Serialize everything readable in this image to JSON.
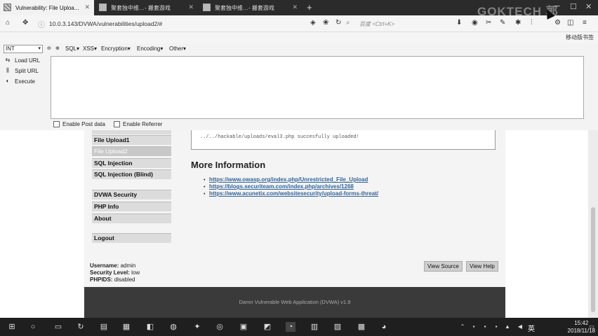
{
  "tabs": [
    {
      "label": "Vulnerability: File Uploa...",
      "active": true
    },
    {
      "label": "聚套独中维…- 搬套游戏",
      "active": false
    },
    {
      "label": "聚套独中维…- 搬套游戏",
      "active": false
    }
  ],
  "watermark": "GOKTECH 郭",
  "navbar": {
    "url": "10.0.3.143/DVWA/vulnerabilities/upload2/#",
    "search_placeholder": "百度 <Ctrl+K>"
  },
  "bookmarks": {
    "mobile": "移动版书签"
  },
  "hackbar": {
    "select_value": "INT",
    "menus": [
      "SQL▾",
      "XSS▾",
      "Encryption▾",
      "Encoding▾",
      "Other▾"
    ],
    "actions": [
      "Load URL",
      "Split URL",
      "Execute"
    ],
    "checkboxes": [
      "Enable Post data",
      "Enable Referrer"
    ]
  },
  "sidebar": {
    "items": [
      {
        "label": "File Upload1",
        "selected": false
      },
      {
        "label": "File Upload2",
        "selected": true
      },
      {
        "label": "SQL Injection",
        "selected": false
      },
      {
        "label": "SQL Injection (Blind)",
        "selected": false
      },
      {
        "label": "DVWA Security",
        "selected": false
      },
      {
        "label": "PHP Info",
        "selected": false
      },
      {
        "label": "About",
        "selected": false
      },
      {
        "label": "Logout",
        "selected": false
      }
    ]
  },
  "main": {
    "upload_message": "../../hackable/uploads/eval3.php succesfully uploaded!",
    "more_info_title": "More Information",
    "links": [
      "https://www.owasp.org/index.php/Unrestricted_File_Upload",
      "https://blogs.securiteam.com/index.php/archives/1268",
      "https://www.acunetix.com/websitesecurity/upload-forms-threat/"
    ]
  },
  "user": {
    "username_label": "Username:",
    "username": "admin",
    "security_label": "Security Level:",
    "security": "low",
    "phpids_label": "PHPIDS:",
    "phpids": "disabled"
  },
  "buttons": {
    "view_source": "View Source",
    "view_help": "View Help"
  },
  "footer": "Damn Vulnerable Web Application (DVWA) v1.9",
  "taskbar": {
    "ime": "英",
    "time": "15:42",
    "date": "2018/11/18"
  }
}
